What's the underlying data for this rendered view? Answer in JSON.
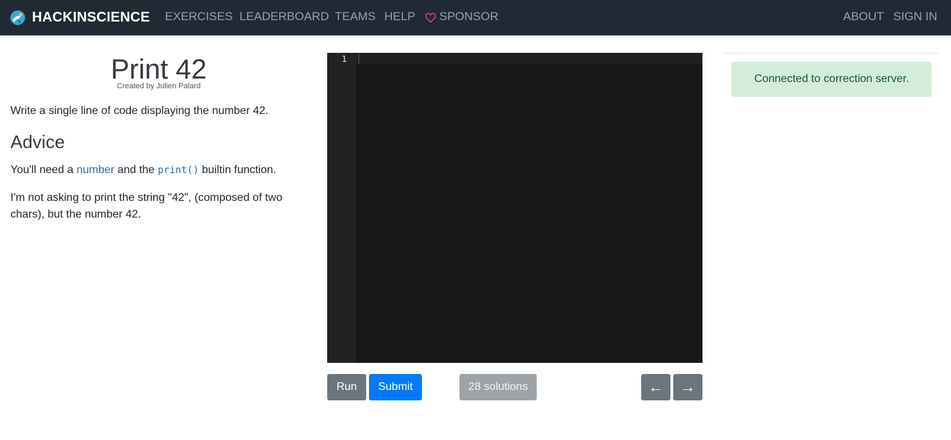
{
  "navbar": {
    "brand": "HACKINSCIENCE",
    "links": {
      "exercises": "EXERCISES",
      "leaderboard": "LEADERBOARD",
      "teams": "TEAMS",
      "help": "HELP",
      "sponsor": "SPONSOR",
      "about": "ABOUT",
      "sign_in": "SIGN IN"
    },
    "colors": {
      "background": "#1f2a35",
      "sponsor_heart": "#e83e8c"
    }
  },
  "exercise": {
    "title": "Print 42",
    "author": "Created by Julien Palard",
    "description": "Write a single line of code displaying the number 42.",
    "advice_heading": "Advice",
    "advice_1": {
      "prefix": "You'll need a ",
      "link_number": "number",
      "middle": " and the ",
      "link_print": "print()",
      "suffix": " builtin function."
    },
    "advice_2": "I'm not asking to print the string \"42\", (composed of two chars), but the number 42."
  },
  "editor": {
    "line_numbers": [
      "1"
    ],
    "content": ""
  },
  "actions": {
    "run": "Run",
    "submit": "Submit",
    "solutions": "28 solutions",
    "prev": "←",
    "next": "→"
  },
  "status": {
    "message": "Connected to correction server.",
    "color": "#d4edda"
  }
}
